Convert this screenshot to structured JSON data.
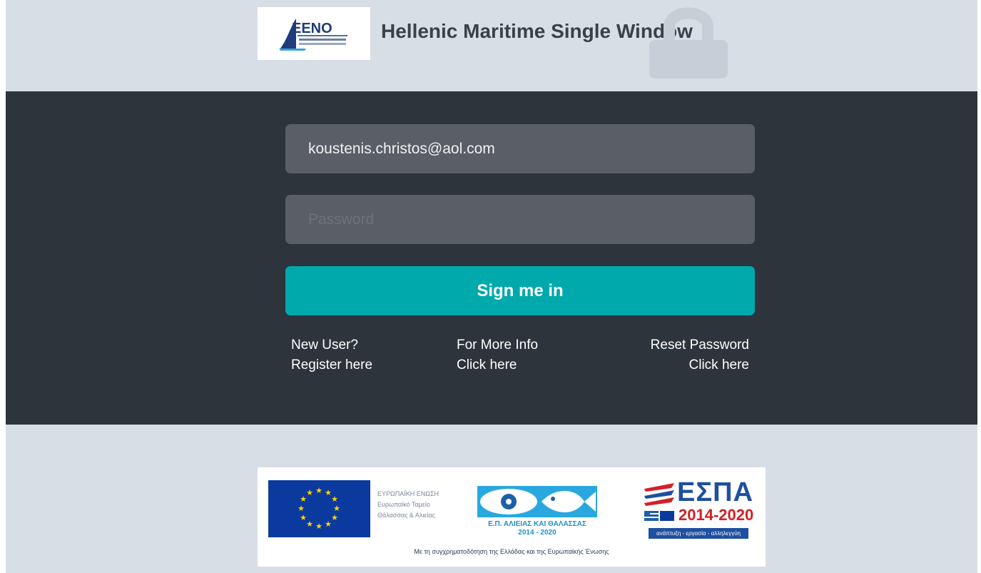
{
  "header": {
    "title": "Hellenic Maritime Single Window",
    "logo_text": "EENO"
  },
  "login": {
    "email_value": "koustenis.christos@aol.com",
    "password_placeholder": "Password",
    "signin_label": "Sign me in",
    "links": {
      "new_user_line1": "New User?",
      "new_user_line2": "Register here",
      "more_info_line1": "For More Info",
      "more_info_line2": "Click here",
      "reset_line1": "Reset Password",
      "reset_line2": "Click here"
    }
  },
  "footer": {
    "eu_text_1": "ΕΥΡΩΠΑΪΚΗ ΕΝΩΣΗ",
    "eu_text_2": "Ευρωπαϊκό Ταμείο",
    "eu_text_3": "Θάλασσας & Αλιείας",
    "fish_caption_1": "Ε.Π. ΑΛΙΕΙΑΣ ΚΑΙ ΘΑΛΑΣΣΑΣ",
    "fish_caption_2": "2014 - 2020",
    "espa_name": "ΕΣΠΑ",
    "espa_years": "2014-2020",
    "espa_motto": "ανάπτυξη - εργασία - αλληλεγγύη",
    "cofund_text": "Με τη συγχρηματοδότηση της Ελλάδας και της Ευρωπαϊκής Ένωσης"
  },
  "colors": {
    "page_bg": "#d8dee6",
    "band_bg": "#2e343b",
    "field_bg": "#5a5e66",
    "accent": "#00a9ab"
  }
}
